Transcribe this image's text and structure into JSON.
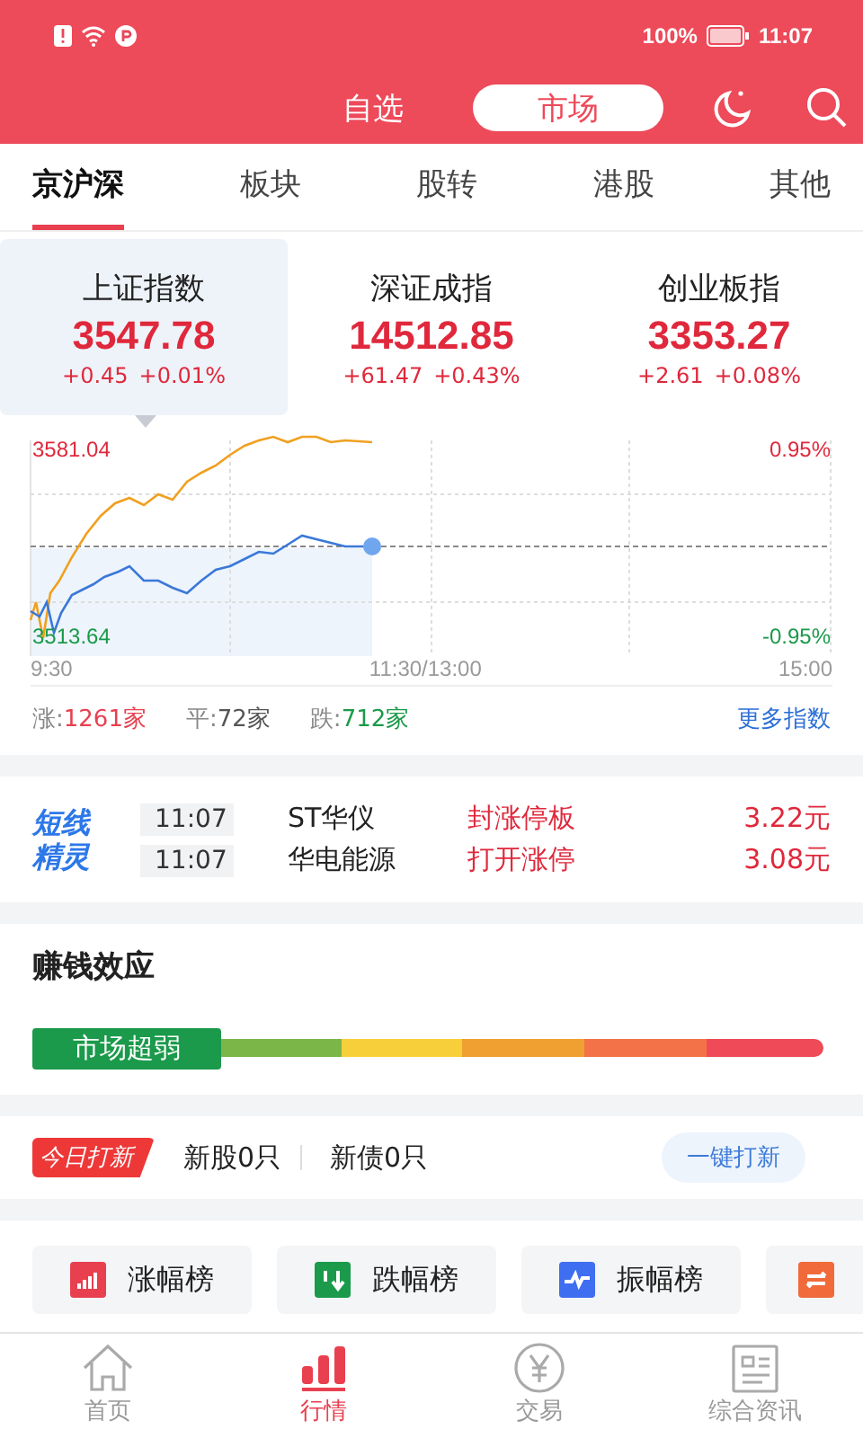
{
  "status_bar": {
    "battery": "100%",
    "time": "11:07"
  },
  "header": {
    "tabs": [
      {
        "label": "自选",
        "selected": false
      },
      {
        "label": "市场",
        "selected": true
      }
    ]
  },
  "market_tabs": [
    {
      "label": "京沪深",
      "selected": true
    },
    {
      "label": "板块",
      "selected": false
    },
    {
      "label": "股转",
      "selected": false
    },
    {
      "label": "港股",
      "selected": false
    },
    {
      "label": "其他",
      "selected": false
    }
  ],
  "indices": [
    {
      "name": "上证指数",
      "value": "3547.78",
      "change": "+0.45",
      "percent": "+0.01%",
      "selected": true
    },
    {
      "name": "深证成指",
      "value": "14512.85",
      "change": "+61.47",
      "percent": "+0.43%",
      "selected": false
    },
    {
      "name": "创业板指",
      "value": "3353.27",
      "change": "+2.61",
      "percent": "+0.08%",
      "selected": false
    }
  ],
  "intraday_chart": {
    "high": "3581.04",
    "low": "3513.64",
    "high_pct": "0.95%",
    "low_pct": "-0.95%",
    "times": [
      "9:30",
      "11:30/13:00",
      "15:00"
    ]
  },
  "breadth": [
    {
      "label": "涨:",
      "count": "1261家",
      "kind": "up"
    },
    {
      "label": "平:",
      "count": "72家",
      "kind": "flat"
    },
    {
      "label": "跌:",
      "count": "712家",
      "kind": "down"
    }
  ],
  "more_indices": "更多指数",
  "short_line": {
    "logo": [
      "短线",
      "精灵"
    ],
    "rows": [
      {
        "time": "11:07",
        "stock": "ST华仪",
        "event": "封涨停板",
        "price": "3.22元"
      },
      {
        "time": "11:07",
        "stock": "华电能源",
        "event": "打开涨停",
        "price": "3.08元"
      }
    ]
  },
  "money_effect": {
    "title": "赚钱效应",
    "label": "市场超弱"
  },
  "ipo": {
    "badge": "今日打新",
    "stocks": "新股0只",
    "bonds": "新债0只",
    "button": "一键打新"
  },
  "rankings": [
    {
      "label": "涨幅榜",
      "kind": "up"
    },
    {
      "label": "跌幅榜",
      "kind": "down"
    },
    {
      "label": "振幅榜",
      "kind": "amplitude"
    },
    {
      "kind": "turnover"
    }
  ],
  "bottom_nav": [
    {
      "label": "首页",
      "kind": "home",
      "selected": false
    },
    {
      "label": "行情",
      "kind": "market",
      "selected": true
    },
    {
      "label": "交易",
      "kind": "trade",
      "selected": false
    },
    {
      "label": "综合资讯",
      "kind": "news",
      "selected": false
    }
  ]
}
